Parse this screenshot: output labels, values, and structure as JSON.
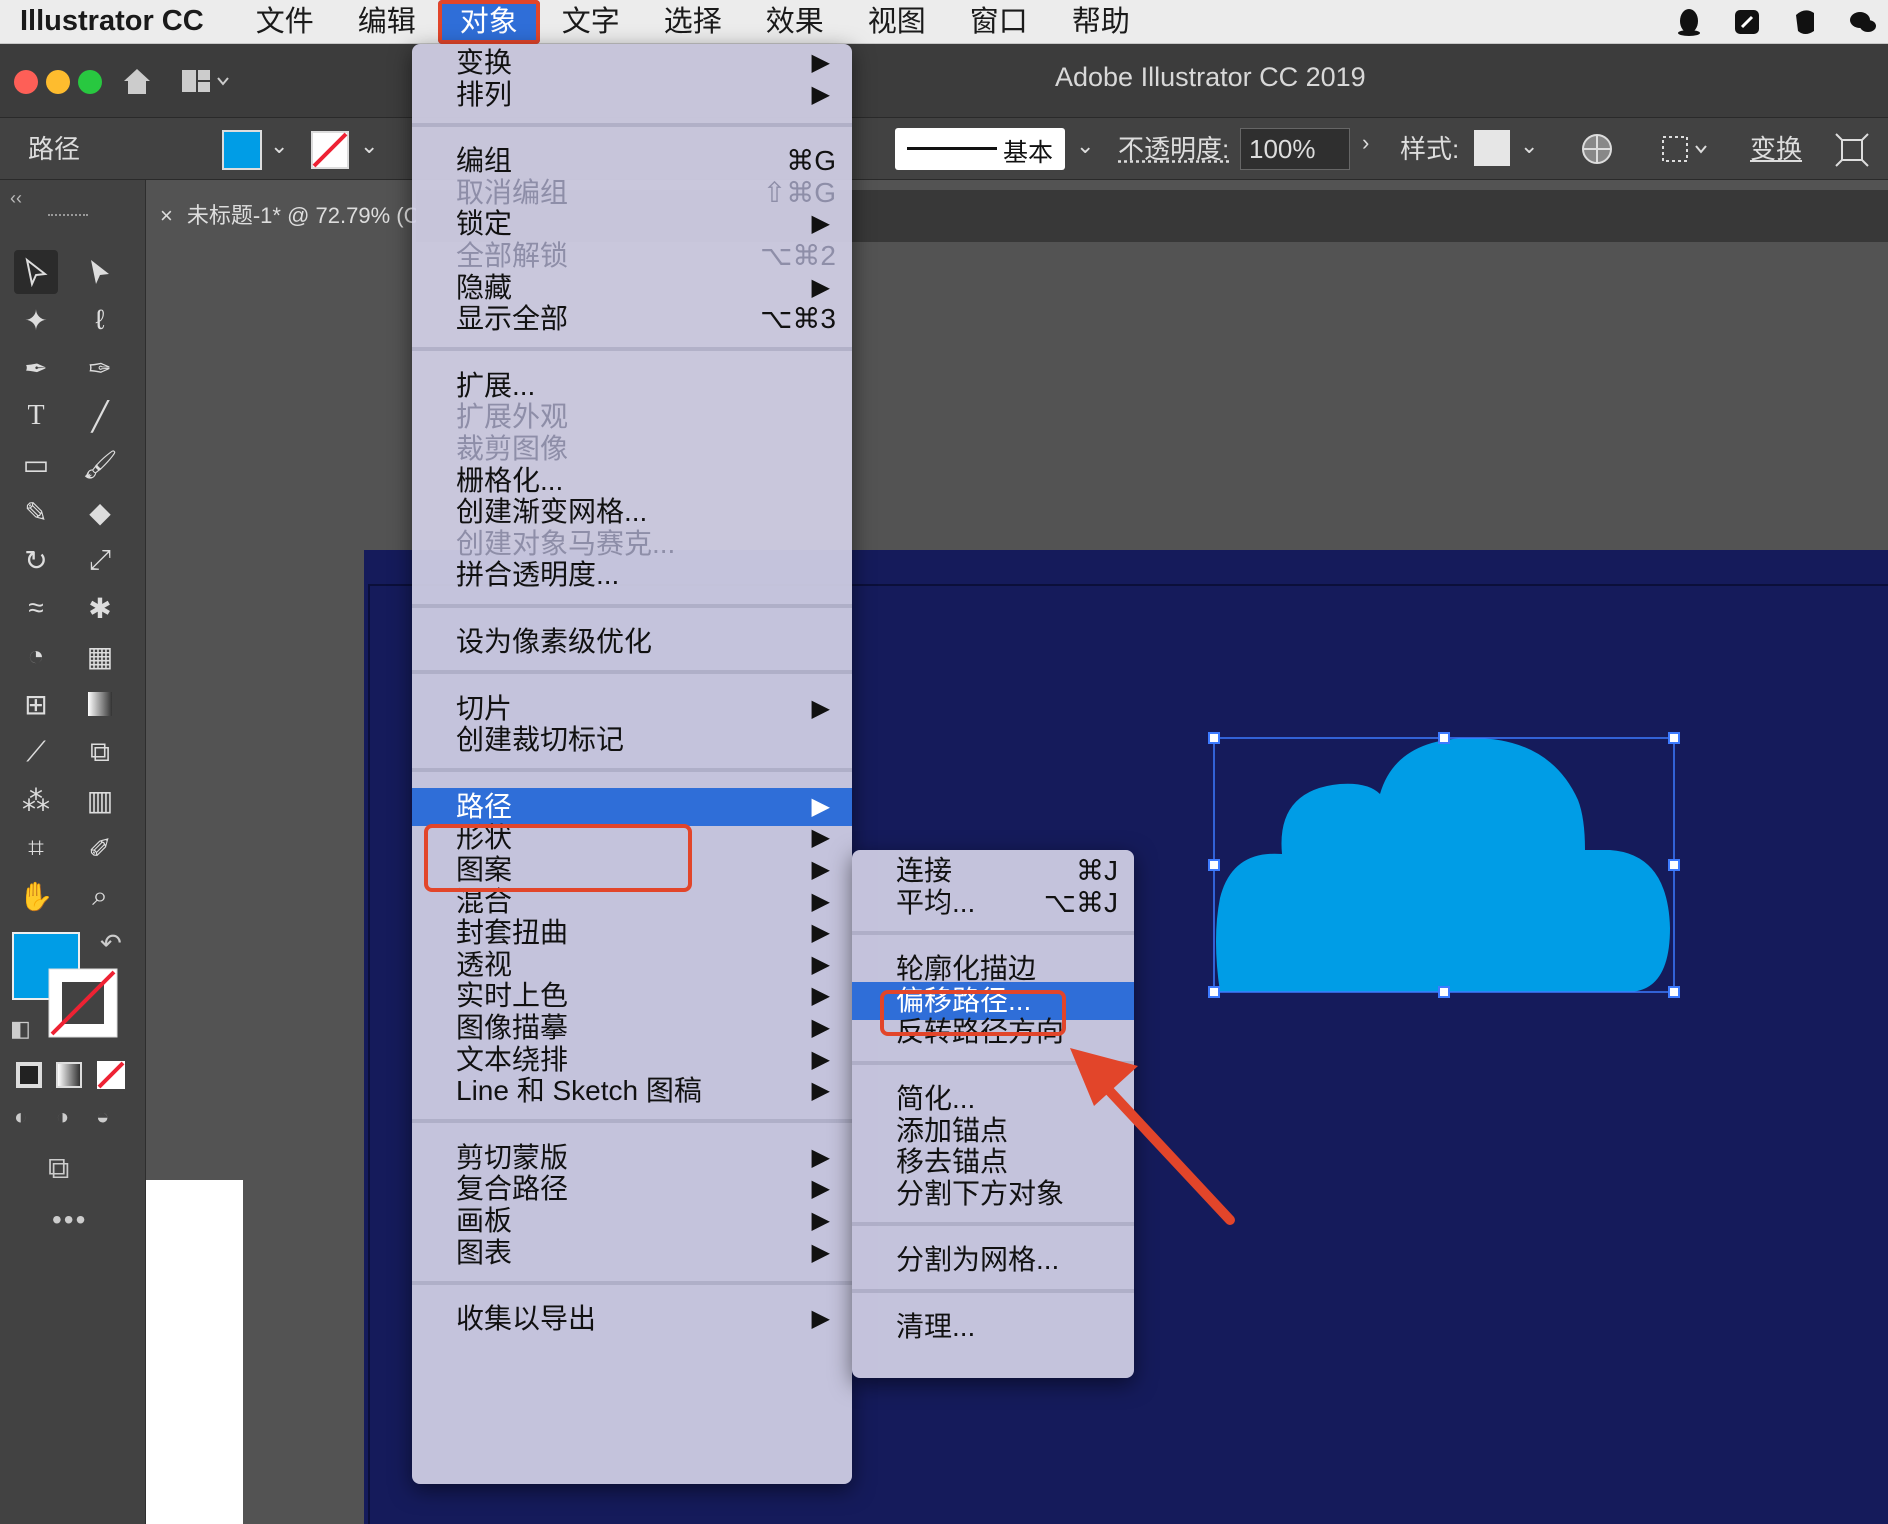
{
  "menubar": {
    "app_name": "Illustrator CC",
    "items": [
      "文件",
      "编辑",
      "对象",
      "文字",
      "选择",
      "效果",
      "视图",
      "窗口",
      "帮助"
    ],
    "active_index": 2
  },
  "window": {
    "title": "Adobe Illustrator CC 2019"
  },
  "controlbar": {
    "selection_label": "路径",
    "stroke_style_label": "基本",
    "opacity_label": "不透明度:",
    "opacity_value": "100%",
    "style_label": "样式:",
    "transform_label": "变换"
  },
  "tab": {
    "close": "×",
    "title": "未标题-1* @ 72.79% (C"
  },
  "object_menu": [
    {
      "label": "变换",
      "submenu": true
    },
    {
      "label": "排列",
      "submenu": true
    },
    {
      "separator": true
    },
    {
      "label": "编组",
      "shortcut": "⌘G"
    },
    {
      "label": "取消编组",
      "shortcut": "⇧⌘G",
      "disabled": true
    },
    {
      "label": "锁定",
      "submenu": true
    },
    {
      "label": "全部解锁",
      "shortcut": "⌥⌘2",
      "disabled": true
    },
    {
      "label": "隐藏",
      "submenu": true
    },
    {
      "label": "显示全部",
      "shortcut": "⌥⌘3"
    },
    {
      "separator": true
    },
    {
      "label": "扩展..."
    },
    {
      "label": "扩展外观",
      "disabled": true
    },
    {
      "label": "裁剪图像",
      "disabled": true
    },
    {
      "label": "栅格化..."
    },
    {
      "label": "创建渐变网格..."
    },
    {
      "label": "创建对象马赛克...",
      "disabled": true
    },
    {
      "label": "拼合透明度..."
    },
    {
      "separator": true
    },
    {
      "label": "设为像素级优化"
    },
    {
      "separator": true
    },
    {
      "label": "切片",
      "submenu": true
    },
    {
      "label": "创建裁切标记"
    },
    {
      "separator": true
    },
    {
      "label": "路径",
      "submenu": true,
      "highlighted": true
    },
    {
      "label": "形状",
      "submenu": true
    },
    {
      "label": "图案",
      "submenu": true
    },
    {
      "label": "混合",
      "submenu": true
    },
    {
      "label": "封套扭曲",
      "submenu": true
    },
    {
      "label": "透视",
      "submenu": true
    },
    {
      "label": "实时上色",
      "submenu": true
    },
    {
      "label": "图像描摹",
      "submenu": true
    },
    {
      "label": "文本绕排",
      "submenu": true
    },
    {
      "label": "Line 和 Sketch 图稿",
      "submenu": true
    },
    {
      "separator": true
    },
    {
      "label": "剪切蒙版",
      "submenu": true
    },
    {
      "label": "复合路径",
      "submenu": true
    },
    {
      "label": "画板",
      "submenu": true
    },
    {
      "label": "图表",
      "submenu": true
    },
    {
      "separator": true
    },
    {
      "label": "收集以导出",
      "submenu": true
    }
  ],
  "path_submenu": [
    {
      "label": "连接",
      "shortcut": "⌘J"
    },
    {
      "label": "平均...",
      "shortcut": "⌥⌘J"
    },
    {
      "separator": true
    },
    {
      "label": "轮廓化描边"
    },
    {
      "label": "偏移路径...",
      "highlighted": true
    },
    {
      "label": "反转路径方向"
    },
    {
      "separator": true
    },
    {
      "label": "简化..."
    },
    {
      "label": "添加锚点"
    },
    {
      "label": "移去锚点"
    },
    {
      "label": "分割下方对象"
    },
    {
      "separator": true
    },
    {
      "label": "分割为网格..."
    },
    {
      "separator": true
    },
    {
      "label": "清理..."
    }
  ],
  "colors": {
    "fill": "#009de6",
    "artboard": "#151b5b",
    "highlight": "#2f6ed8",
    "annotation": "#e2452a"
  },
  "arrow_submenu": "▶",
  "icons": [
    "qq-icon",
    "notes-icon",
    "evernote-icon",
    "wechat-icon",
    "home-icon",
    "layout-icon",
    "fill-swatch-icon",
    "stroke-none-icon",
    "stroke-weight-icon",
    "recolor-icon",
    "align-icon",
    "transform-icon",
    "selection-tool-icon",
    "direct-selection-tool-icon",
    "magic-wand-icon",
    "lasso-icon",
    "pen-tool-icon",
    "curvature-tool-icon",
    "type-tool-icon",
    "line-tool-icon",
    "rectangle-tool-icon",
    "paintbrush-icon",
    "shaper-tool-icon",
    "eraser-icon",
    "rotate-icon",
    "scale-icon",
    "warp-icon",
    "puppet-warp-icon",
    "shape-builder-icon",
    "perspective-grid-icon",
    "mesh-icon",
    "gradient-icon",
    "eyedropper-icon",
    "blend-icon",
    "symbol-sprayer-icon",
    "graph-icon",
    "artboard-tool-icon",
    "slice-icon",
    "hand-icon",
    "zoom-icon",
    "swap-colors-icon",
    "default-colors-icon",
    "screen-mode-icon",
    "cloud-shape-icon",
    "arrow-annotation-icon"
  ]
}
